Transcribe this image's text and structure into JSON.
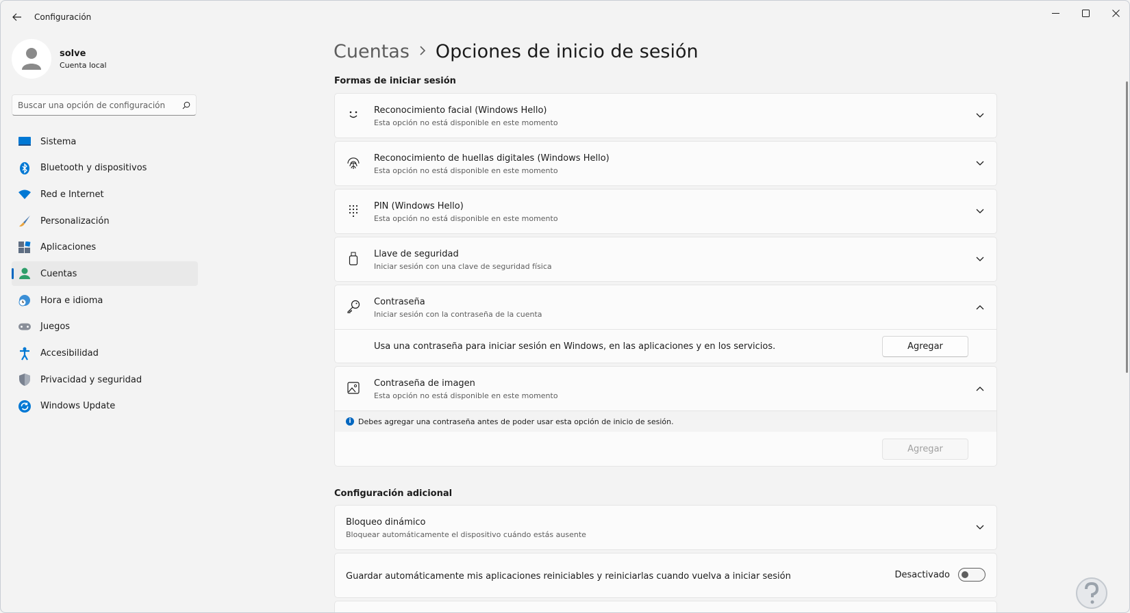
{
  "window": {
    "title": "Configuración"
  },
  "profile": {
    "name": "solve",
    "subtitle": "Cuenta local"
  },
  "search": {
    "placeholder": "Buscar una opción de configuración"
  },
  "nav": {
    "items": [
      {
        "label": "Sistema",
        "icon": "monitor-icon"
      },
      {
        "label": "Bluetooth y dispositivos",
        "icon": "bluetooth-icon"
      },
      {
        "label": "Red e Internet",
        "icon": "wifi-icon"
      },
      {
        "label": "Personalización",
        "icon": "brush-icon"
      },
      {
        "label": "Aplicaciones",
        "icon": "apps-icon"
      },
      {
        "label": "Cuentas",
        "icon": "person-icon",
        "active": true
      },
      {
        "label": "Hora e idioma",
        "icon": "globe-clock-icon"
      },
      {
        "label": "Juegos",
        "icon": "gamepad-icon"
      },
      {
        "label": "Accesibilidad",
        "icon": "accessibility-icon"
      },
      {
        "label": "Privacidad y seguridad",
        "icon": "shield-icon"
      },
      {
        "label": "Windows Update",
        "icon": "update-icon"
      }
    ]
  },
  "breadcrumb": {
    "parent": "Cuentas",
    "current": "Opciones de inicio de sesión"
  },
  "sections": {
    "ways": "Formas de iniciar sesión",
    "additional": "Configuración adicional"
  },
  "signin": {
    "face": {
      "title": "Reconocimiento facial (Windows Hello)",
      "sub": "Esta opción no está disponible en este momento"
    },
    "fingerprint": {
      "title": "Reconocimiento de huellas digitales (Windows Hello)",
      "sub": "Esta opción no está disponible en este momento"
    },
    "pin": {
      "title": "PIN (Windows Hello)",
      "sub": "Esta opción no está disponible en este momento"
    },
    "key": {
      "title": "Llave de seguridad",
      "sub": "Iniciar sesión con una clave de seguridad física"
    },
    "password": {
      "title": "Contraseña",
      "sub": "Iniciar sesión con la contraseña de la cuenta",
      "detail": "Usa una contraseña para iniciar sesión en Windows, en las aplicaciones y en los servicios.",
      "button": "Agregar"
    },
    "picture": {
      "title": "Contraseña de imagen",
      "sub": "Esta opción no está disponible en este momento",
      "info": "Debes agregar una contraseña antes de poder usar esta opción de inicio de sesión.",
      "button": "Agregar"
    }
  },
  "additional": {
    "dynamic_lock": {
      "title": "Bloqueo dinámico",
      "sub": "Bloquear automáticamente el dispositivo cuándo estás ausente"
    },
    "restart_apps": {
      "title": "Guardar automáticamente mis aplicaciones reiniciables y reiniciarlas cuando vuelva a iniciar sesión",
      "state": "Desactivado",
      "on": false
    }
  },
  "colors": {
    "accent": "#0067c0",
    "background": "#f3f3f3",
    "card": "#fbfbfb"
  }
}
